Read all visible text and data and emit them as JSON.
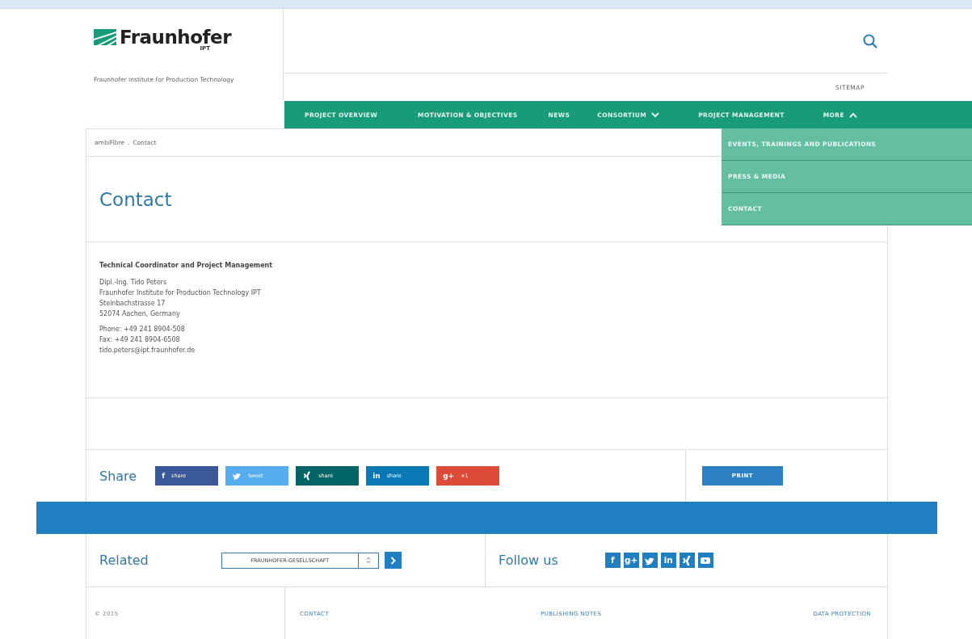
{
  "header": {
    "logo": {
      "name": "Fraunhofer",
      "unit": "IPT"
    },
    "tagline": "Fraunhofer Institute for Production Technology",
    "sitemap": "SITEMAP"
  },
  "nav": [
    {
      "label": "PROJECT OVERVIEW",
      "kind": "link"
    },
    {
      "label": "MOTIVATION & OBJECTIVES",
      "kind": "link"
    },
    {
      "label": "NEWS",
      "kind": "link"
    },
    {
      "label": "CONSORTIUM",
      "kind": "dropdown",
      "expanded": false
    },
    {
      "label": "PROJECT MANAGEMENT",
      "kind": "link"
    },
    {
      "label": "MORE",
      "kind": "dropdown",
      "expanded": true,
      "children": [
        "EVENTS, TRAININGS AND PUBLICATIONS",
        "PRESS & MEDIA",
        "CONTACT"
      ]
    }
  ],
  "breadcrumb": {
    "items": [
      "ambiFibre",
      "Contact"
    ],
    "separator": "."
  },
  "title": "Contact",
  "contact": {
    "heading": "Technical Coordinator and Project Management",
    "address": [
      "Dipl.-Ing. Tido Peters",
      "Fraunhofer Institute for Production Technology IPT",
      "Steinbachstrasse 17",
      "52074 Aachen, Germany"
    ],
    "phone": "Phone: +49 241 8904-508",
    "fax": "Fax: +49 241 8904-6508",
    "email": "tido.peters@ipt.fraunhofer.de"
  },
  "share": {
    "label": "Share",
    "buttons": [
      {
        "kind": "facebook",
        "glyph": "f",
        "label": "share",
        "color": "#3b5998"
      },
      {
        "kind": "twitter",
        "label": "tweet",
        "color": "#55acee"
      },
      {
        "kind": "xing",
        "label": "share",
        "color": "#026466"
      },
      {
        "kind": "linkedin",
        "glyph": "in",
        "label": "share",
        "color": "#0a78b5"
      },
      {
        "kind": "googleplus",
        "glyph": "g+",
        "label": "+1",
        "color": "#dd4b39"
      }
    ],
    "print": "PRINT"
  },
  "related": {
    "label": "Related",
    "select": "FRAUNHOFER-GESELLSCHAFT"
  },
  "follow": {
    "label": "Follow us",
    "icons": [
      {
        "kind": "facebook",
        "glyph": "f"
      },
      {
        "kind": "googleplus",
        "glyph": "g+"
      },
      {
        "kind": "twitter"
      },
      {
        "kind": "linkedin",
        "glyph": "in"
      },
      {
        "kind": "xing"
      },
      {
        "kind": "youtube"
      }
    ]
  },
  "footer": [
    "© 2015",
    "CONTACT",
    "PUBLISHING NOTES",
    "DATA PROTECTION"
  ]
}
